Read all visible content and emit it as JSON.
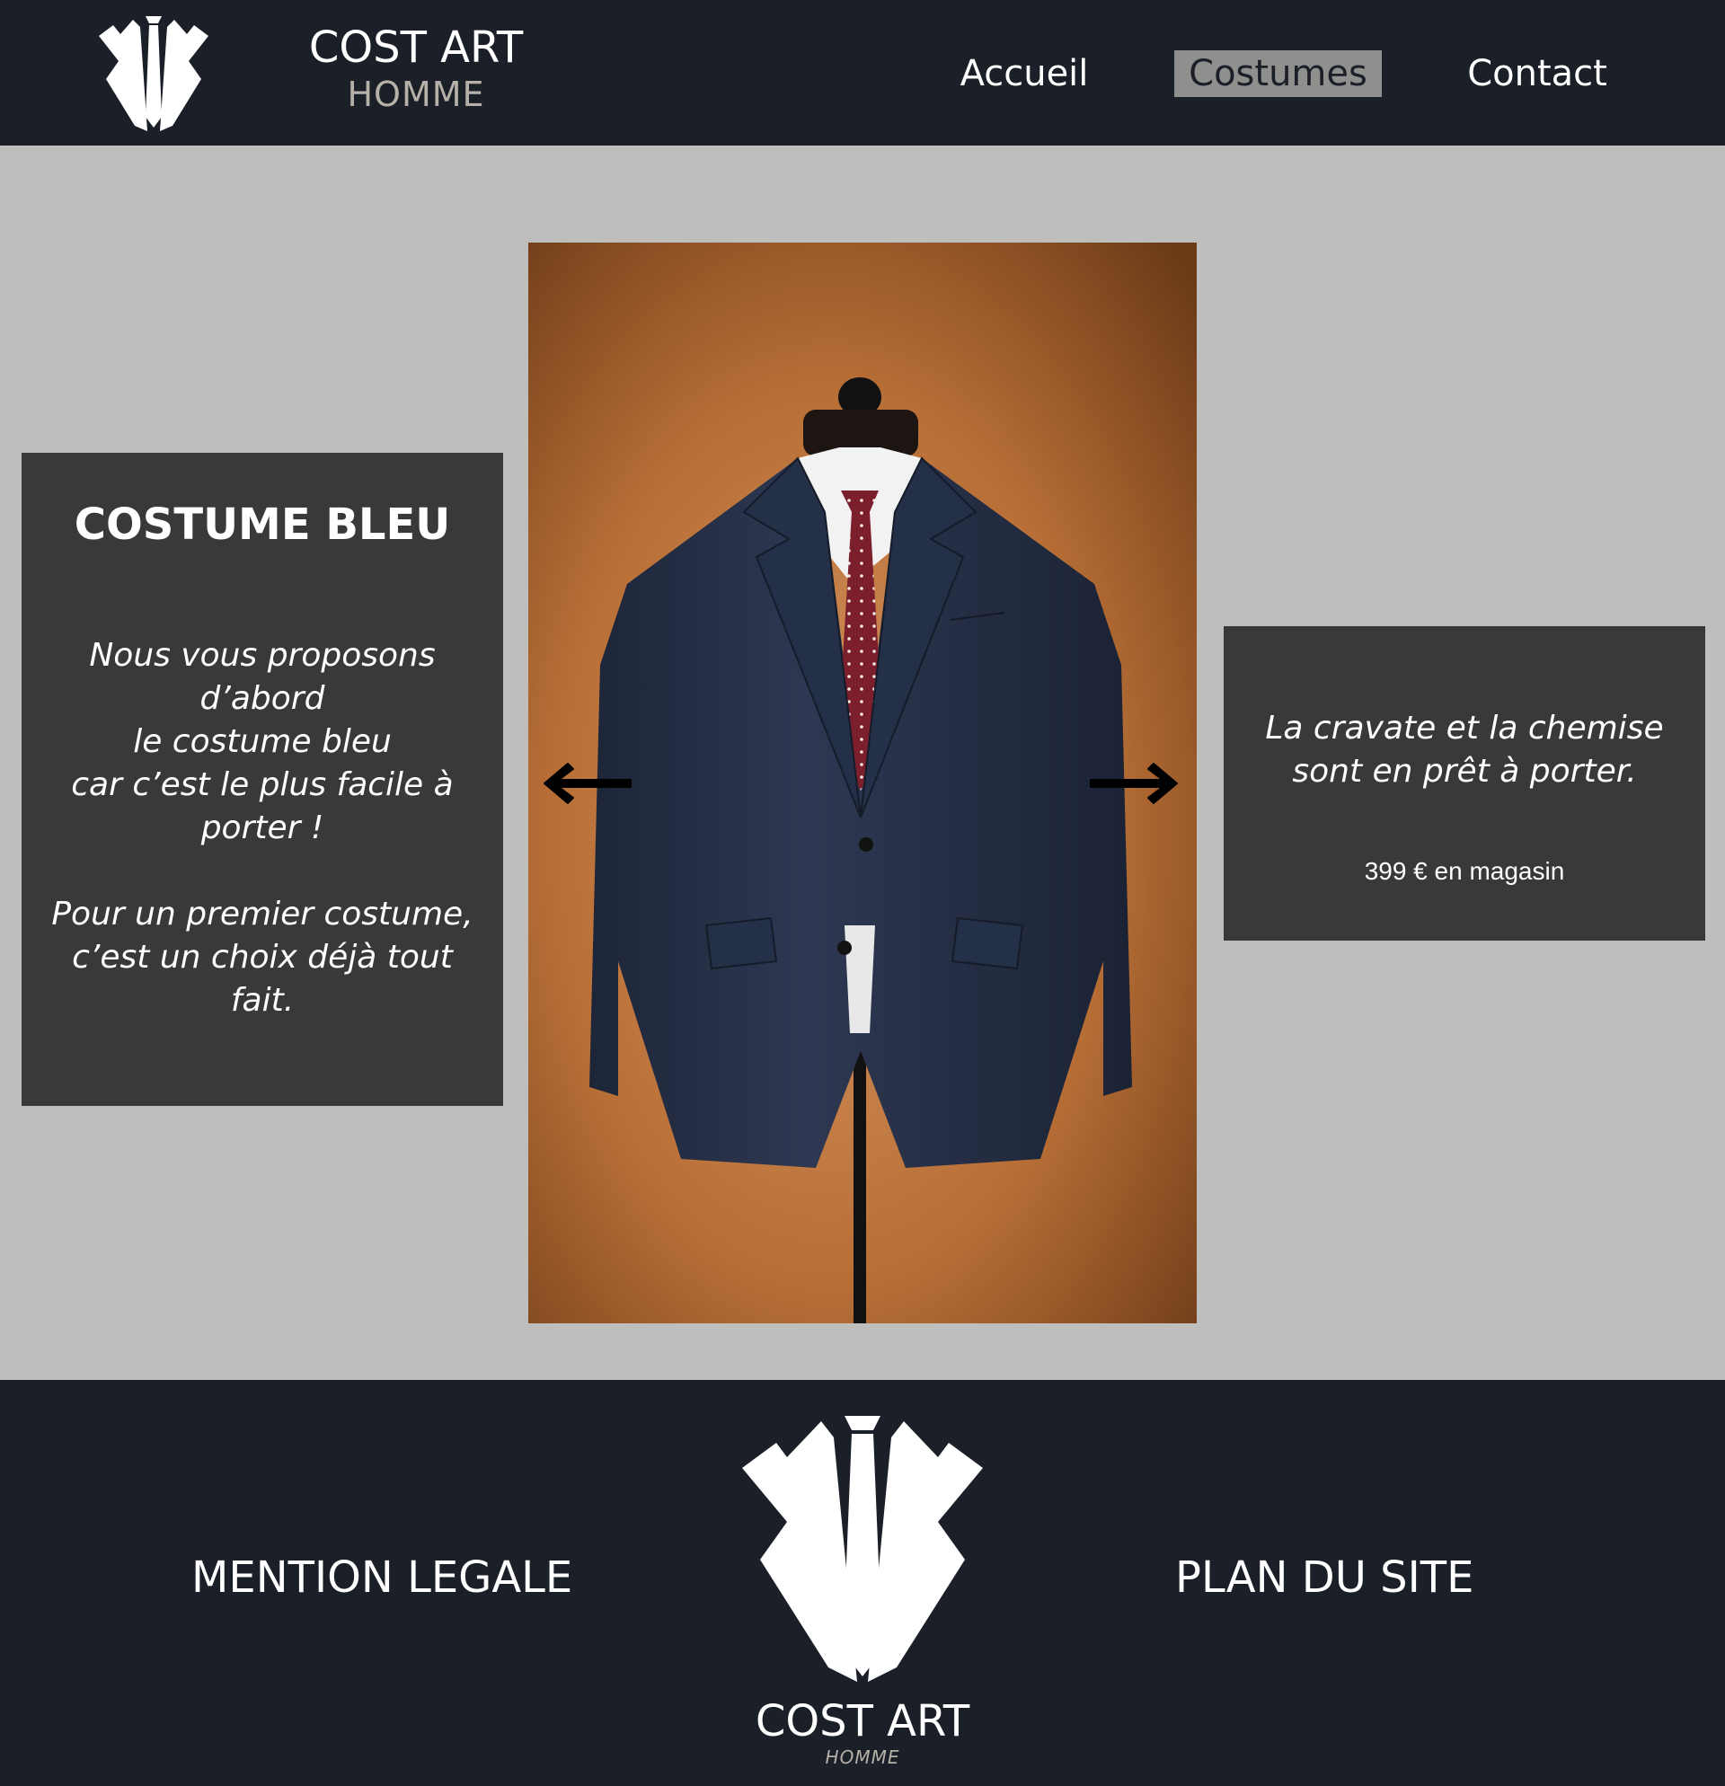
{
  "header": {
    "brand_name": "COST ART",
    "brand_sub": "HOMME",
    "logo_icon": "tuxedo-lapel-tie-icon",
    "nav": [
      {
        "label": "Accueil",
        "active": false
      },
      {
        "label": "Costumes",
        "active": true
      },
      {
        "label": "Contact",
        "active": false
      }
    ]
  },
  "main": {
    "product_title": "COSTUME BLEU",
    "description_lines": [
      "Nous vous proposons",
      "d’abord",
      "le costume bleu",
      "car c’est le plus facile à",
      "porter !"
    ],
    "description_lines_2": [
      "Pour un premier costume,",
      "c’est un choix déjà tout",
      "fait."
    ],
    "side_note_lines": [
      "La cravate et la chemise",
      "sont en prêt à porter."
    ],
    "price_text": "399 € en magasin",
    "prev_icon": "arrow-left-icon",
    "next_icon": "arrow-right-icon",
    "photo_subject": "navy-suit-on-mannequin-image"
  },
  "footer": {
    "mention_label": "MENTION LEGALE",
    "plan_label": "PLAN DU SITE",
    "brand_name": "COST ART",
    "brand_sub": "HOMME"
  },
  "colors": {
    "header_bg": "#1b1f27",
    "page_bg": "#bebebc",
    "panel_bg": "#393938",
    "nav_active_bg": "#8f8f8e",
    "suit_navy": "#28324a",
    "tie_red": "#7c1f2d",
    "photo_bg": "#c27d45"
  }
}
